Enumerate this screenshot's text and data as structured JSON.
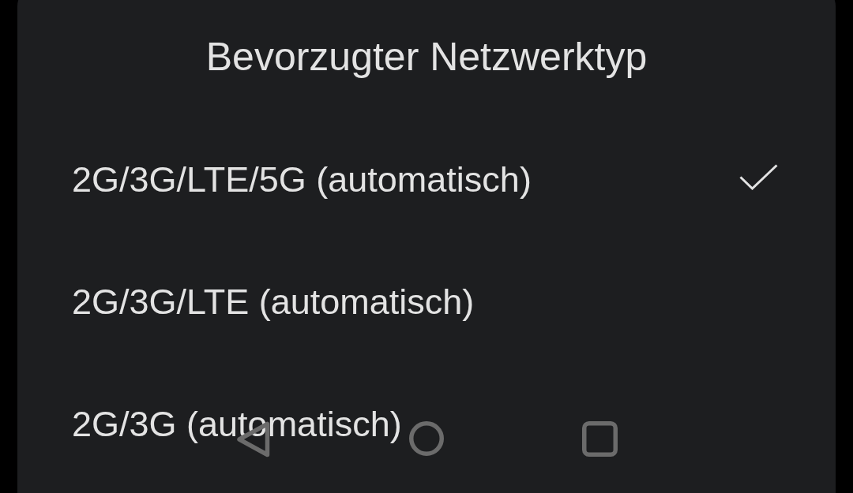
{
  "dialog": {
    "title": "Bevorzugter Netzwerktyp",
    "options": [
      {
        "label": "2G/3G/LTE/5G (automatisch)",
        "selected": true
      },
      {
        "label": "2G/3G/LTE (automatisch)",
        "selected": false
      },
      {
        "label": "2G/3G (automatisch)",
        "selected": false
      }
    ]
  }
}
